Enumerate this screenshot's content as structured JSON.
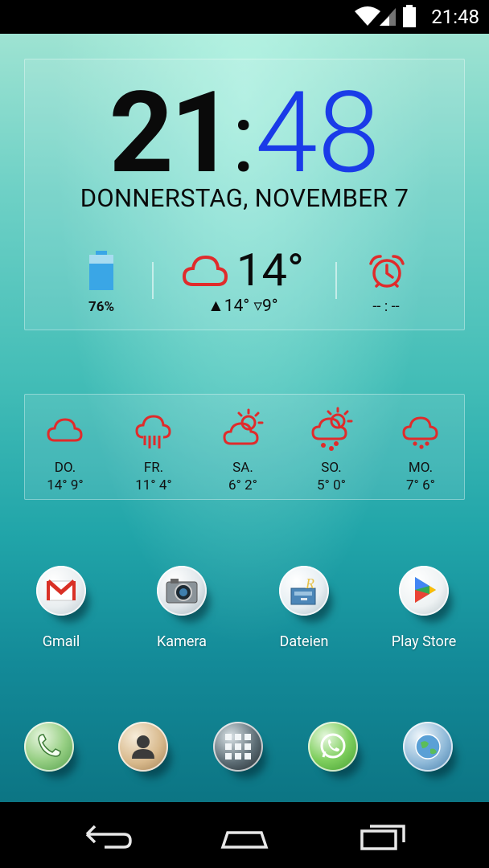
{
  "status_bar": {
    "time": "21:48",
    "icons": [
      "wifi-icon",
      "signal-icon",
      "battery-icon"
    ]
  },
  "clock_widget": {
    "hours": "21",
    "separator": ":",
    "minutes": "48",
    "date": "DONNERSTAG, NOVEMBER 7",
    "battery_percent": "76%",
    "battery_level": 0.76,
    "weather_icon": "cloud-icon",
    "temperature": "14°",
    "high_low": "▲14° ▿9°",
    "alarm_icon": "alarm-clock-icon",
    "alarm_time": "-- : --",
    "colors": {
      "hours": "#0a0a0a",
      "minutes": "#1a3be8",
      "weather": "#e02b2b",
      "battery": "#3aa6e6"
    }
  },
  "forecast": [
    {
      "day": "DO.",
      "temps": "14° 9°",
      "icon": "cloud-icon"
    },
    {
      "day": "FR.",
      "temps": "11° 4°",
      "icon": "cloud-rain-icon"
    },
    {
      "day": "SA.",
      "temps": "6° 2°",
      "icon": "sun-cloud-icon"
    },
    {
      "day": "SO.",
      "temps": "5° 0°",
      "icon": "sun-cloud-rain-icon"
    },
    {
      "day": "MO.",
      "temps": "7° 6°",
      "icon": "cloud-drizzle-icon"
    }
  ],
  "apps": [
    {
      "label": "Gmail",
      "icon": "gmail-icon"
    },
    {
      "label": "Kamera",
      "icon": "camera-icon"
    },
    {
      "label": "Dateien",
      "icon": "file-manager-icon"
    },
    {
      "label": "Play Store",
      "icon": "play-store-icon"
    }
  ],
  "dock": [
    {
      "icon": "phone-icon"
    },
    {
      "icon": "contacts-icon"
    },
    {
      "icon": "app-drawer-icon"
    },
    {
      "icon": "whatsapp-icon"
    },
    {
      "icon": "browser-globe-icon"
    }
  ],
  "nav": [
    "back-icon",
    "home-icon",
    "recents-icon"
  ]
}
